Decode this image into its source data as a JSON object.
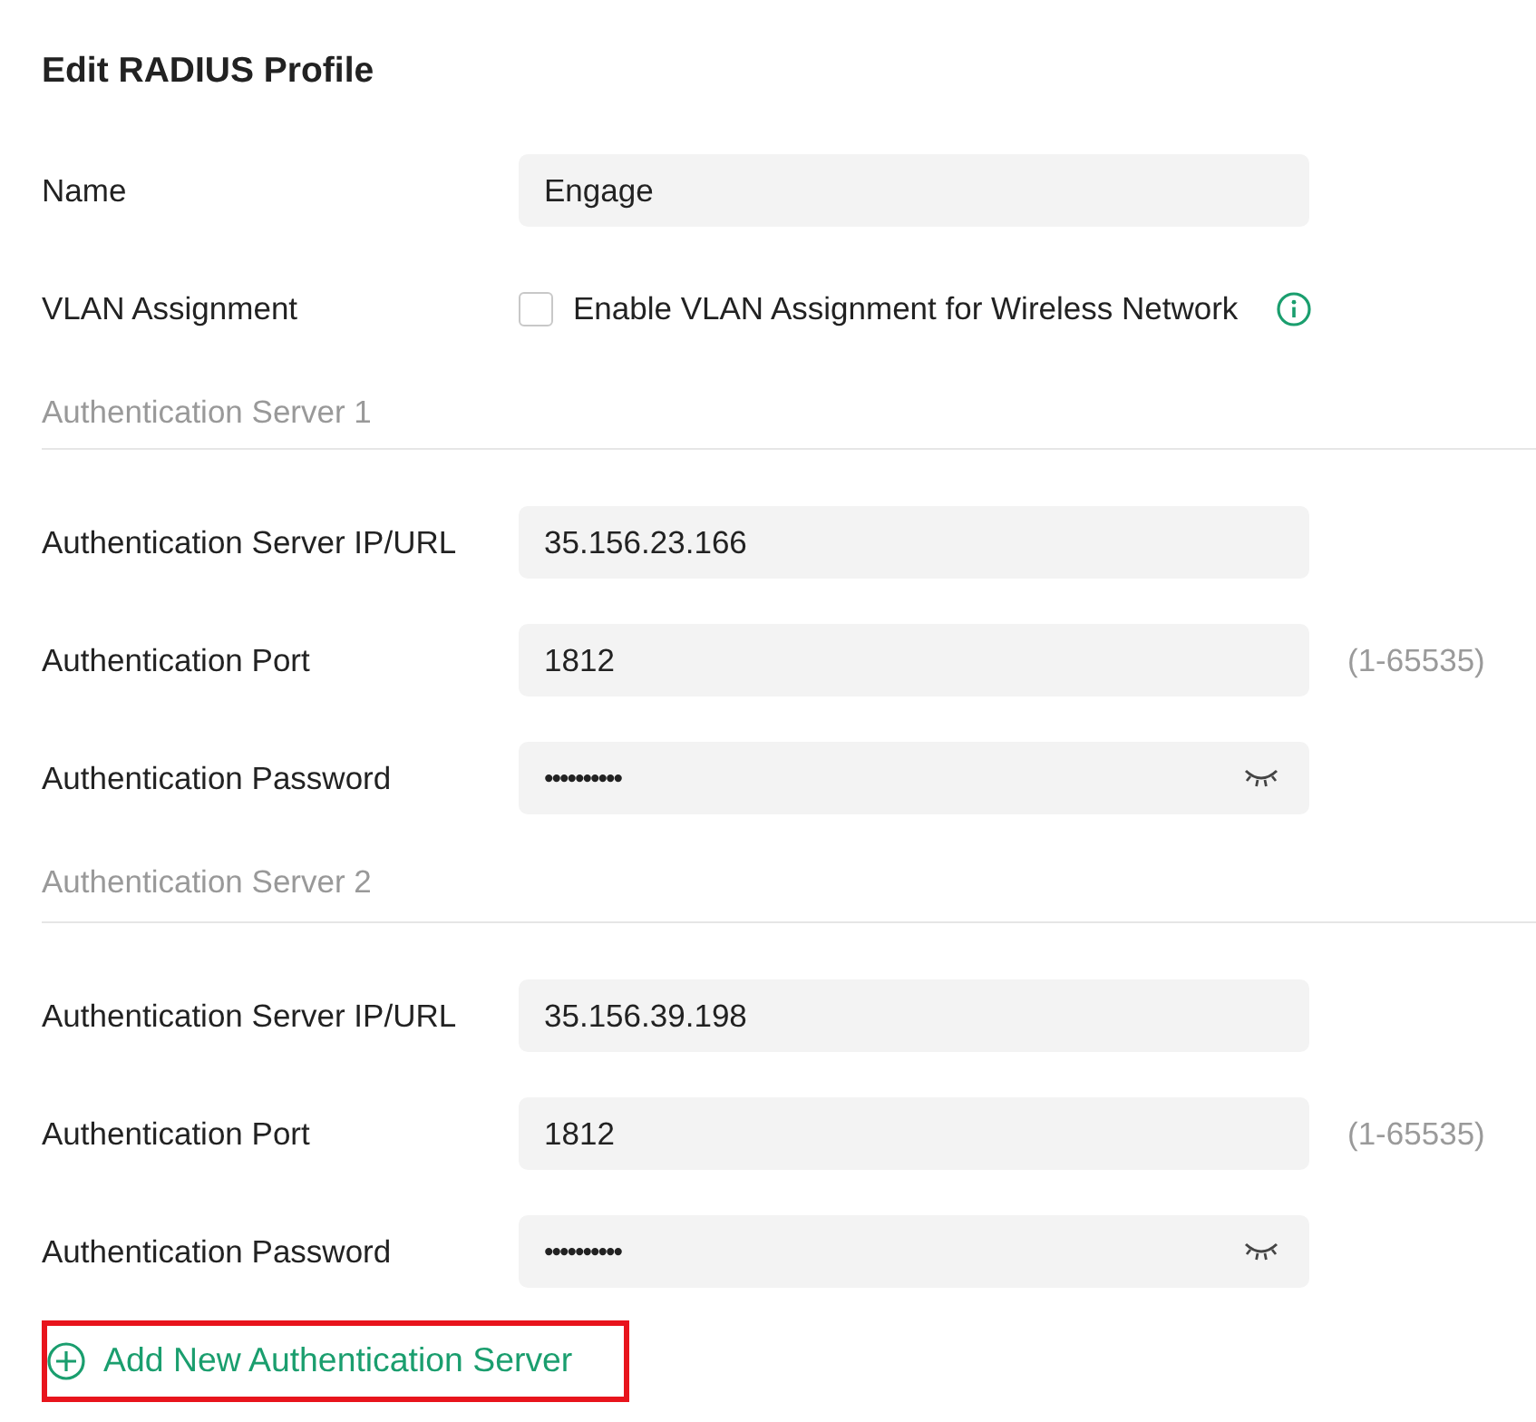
{
  "title": "Edit RADIUS Profile",
  "fields": [
    {
      "label": "Name",
      "kind": "text",
      "value": "Engage"
    },
    {
      "label": "VLAN Assignment",
      "kind": "checkbox",
      "option": "Enable VLAN Assignment for Wireless Network",
      "checked": false,
      "info": true
    }
  ],
  "servers": [
    {
      "heading": "Authentication Server 1",
      "fields": [
        {
          "label": "Authentication Server IP/URL",
          "kind": "text",
          "value": "35.156.23.166"
        },
        {
          "label": "Authentication Port",
          "kind": "text",
          "value": "1812",
          "hint": "(1-65535)"
        },
        {
          "label": "Authentication Password",
          "kind": "password",
          "value": "••••••••••"
        }
      ]
    },
    {
      "heading": "Authentication Server 2",
      "fields": [
        {
          "label": "Authentication Server IP/URL",
          "kind": "text",
          "value": "35.156.39.198"
        },
        {
          "label": "Authentication Port",
          "kind": "text",
          "value": "1812",
          "hint": "(1-65535)"
        },
        {
          "label": "Authentication Password",
          "kind": "password",
          "value": "••••••••••"
        }
      ]
    }
  ],
  "add_server": {
    "label": "Add New Authentication Server",
    "highlighted": true
  }
}
